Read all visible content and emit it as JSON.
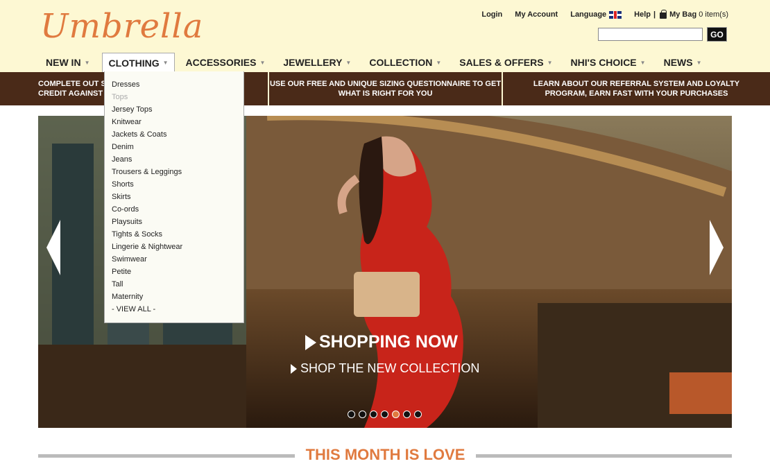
{
  "brand": {
    "logo": "Umbrella",
    "accent": "#e07a3f",
    "header_bg": "#fdf8d3",
    "promo_bg": "#4a2a18"
  },
  "toplinks": {
    "login": "Login",
    "account": "My Account",
    "language": "Language",
    "bag": "My Bag",
    "bag_count": "0 item(s)",
    "separator": "|"
  },
  "search": {
    "placeholder": "",
    "go_label": "GO"
  },
  "nav": [
    {
      "label": "NEW IN"
    },
    {
      "label": "CLOTHING"
    },
    {
      "label": "ACCESSORIES"
    },
    {
      "label": "JEWELLERY"
    },
    {
      "label": "COLLECTION"
    },
    {
      "label": "SALES & OFFERS"
    },
    {
      "label": "NHI'S CHOICE"
    },
    {
      "label": "NEWS"
    }
  ],
  "promo": {
    "p1_line1": "COMPLETE OUT S",
    "p1_line2": "CREDIT AGAINST Y",
    "p2_line1": "USE OUR FREE AND UNIQUE SIZING QUESTIONNAIRE TO GET",
    "p2_line2": "WHAT IS RIGHT FOR YOU",
    "p3_line1": "LEARN ABOUT OUR REFERRAL SYSTEM AND LOYALTY",
    "p3_line2": "PROGRAM, EARN FAST WITH YOUR PURCHASES"
  },
  "dropdown": {
    "items": [
      "Dresses",
      "Tops",
      "Jersey Tops",
      "Knitwear",
      "Jackets & Coats",
      "Denim",
      "Jeans",
      "Trousers & Leggings",
      "Shorts",
      "Skirts",
      "Co-ords",
      "Playsuits",
      "Tights & Socks",
      "Lingerie & Nightwear",
      "Swimwear",
      "Petite",
      "Tall",
      "Maternity",
      "- VIEW ALL -"
    ],
    "hovered_index": 1
  },
  "hero": {
    "cta_primary": "SHOPPING NOW",
    "cta_secondary": "SHOP THE NEW COLLECTION",
    "slides_total": 7,
    "active_slide": 5
  },
  "section": {
    "title": "THIS MONTH IS LOVE"
  },
  "icons": {
    "prev": "chevron-left-icon",
    "next": "chevron-right-icon",
    "flag": "uk-flag-icon",
    "bag": "bag-icon"
  }
}
